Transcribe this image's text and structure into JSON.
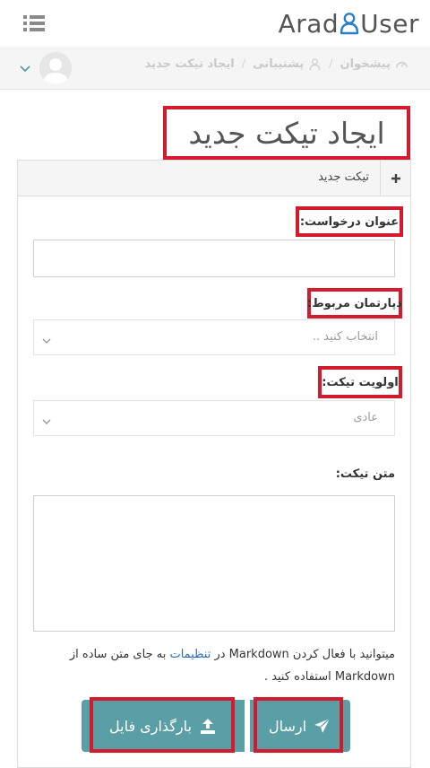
{
  "header": {
    "logo_left": "Arad",
    "logo_right": "User"
  },
  "breadcrumb": {
    "items": [
      {
        "label": "پیشخوان",
        "icon": "speedometer-icon"
      },
      {
        "label": "پشتیبانی",
        "icon": "user-support-icon"
      },
      {
        "label": "ایجاد تیکت جدید",
        "icon": ""
      }
    ],
    "separator": "/"
  },
  "page": {
    "title": "ایجاد تیکت جدید"
  },
  "panel": {
    "heading": "تیکت جدید",
    "fields": {
      "subject_label": "عنوان درخواست:",
      "subject_value": "",
      "department_label": "دپارتمان مربوط:",
      "department_value": "انتخاب کنید ..",
      "priority_label": "اولویت تیکت:",
      "priority_value": "عادی",
      "body_label": "متن تیکت:",
      "body_value": ""
    },
    "help": {
      "part1": "میتوانید با فعال کردن Markdown در ",
      "link": "تنظیمات",
      "part2": " به جای متن ساده از Markdown استفاده کنید ."
    },
    "buttons": {
      "send_label": "ارسال",
      "upload_label": "بارگذاری فایل"
    }
  },
  "colors": {
    "accent": "#5a9ea6",
    "highlight": "#d31b2e",
    "link": "#2a6bb1"
  }
}
